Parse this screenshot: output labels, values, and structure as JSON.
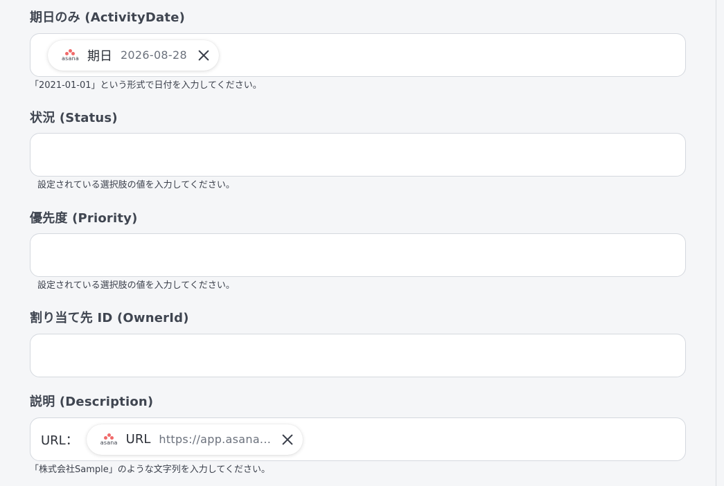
{
  "fields": [
    {
      "label": "期日のみ (ActivityDate)",
      "chip": {
        "logo_text": "asana",
        "name": "期日",
        "value": "2026-08-28"
      },
      "help": "「2021-01-01」という形式で日付を入力してください。"
    },
    {
      "label": "状況 (Status)",
      "help": "設定されている選択肢の値を入力してください。"
    },
    {
      "label": "優先度 (Priority)",
      "help": "設定されている選択肢の値を入力してください。"
    },
    {
      "label": "割り当て先 ID (OwnerId)"
    },
    {
      "label": "説明 (Description)",
      "prefix": "URL：",
      "chip": {
        "logo_text": "asana",
        "name": "URL",
        "value": "https://app.asana..."
      },
      "help": "「株式会社Sample」のような文字列を入力してください。"
    }
  ],
  "colors": {
    "accent_logo": "#f06a6a",
    "background": "#f5f6f8",
    "input_border": "#d4d8de"
  }
}
